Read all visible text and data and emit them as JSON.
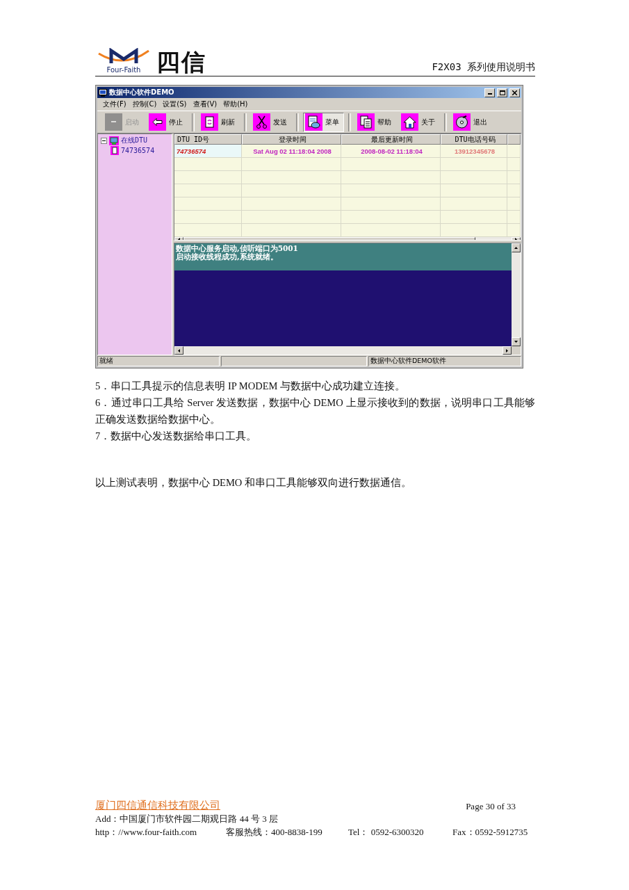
{
  "header": {
    "logo_text": "Four-Faith",
    "logo_mark": "四信",
    "doc_title": "F2X03 系列使用说明书"
  },
  "window": {
    "title": "数据中心软件DEMO",
    "menu": [
      {
        "label": "文件(F)"
      },
      {
        "label": "控制(C)"
      },
      {
        "label": "设置(S)"
      },
      {
        "label": "查看(V)"
      },
      {
        "label": "帮助(H)"
      }
    ],
    "toolbar": [
      {
        "kind": "start",
        "label": "启动",
        "disabled": true,
        "pressed": false,
        "separator_before": false
      },
      {
        "kind": "stop",
        "label": "停止",
        "disabled": false,
        "pressed": false,
        "separator_before": false
      },
      {
        "kind": "refresh",
        "label": "刷新",
        "disabled": false,
        "pressed": false,
        "separator_before": true
      },
      {
        "kind": "send",
        "label": "发送",
        "disabled": false,
        "pressed": false,
        "separator_before": true
      },
      {
        "kind": "menu",
        "label": "菜单",
        "disabled": false,
        "pressed": true,
        "separator_before": true
      },
      {
        "kind": "help",
        "label": "帮助",
        "disabled": false,
        "pressed": false,
        "separator_before": true
      },
      {
        "kind": "about",
        "label": "关于",
        "disabled": false,
        "pressed": false,
        "separator_before": false
      },
      {
        "kind": "exit",
        "label": "退出",
        "disabled": false,
        "pressed": false,
        "separator_before": true
      }
    ],
    "tree": [
      {
        "label": "在线DTU",
        "expanded": true,
        "children": [
          {
            "label": "74736574"
          }
        ]
      }
    ],
    "table": {
      "columns": [
        {
          "label": "DTU ID号",
          "color": "#d01818"
        },
        {
          "label": "登录时间",
          "color": "#c024c0"
        },
        {
          "label": "最后更新时间",
          "color": "#c024c0"
        },
        {
          "label": "DTU电话号码",
          "color": "#e07878"
        }
      ],
      "rows": [
        {
          "selected": true,
          "cells": [
            "74736574",
            "Sat Aug 02 11:18:04 2008",
            "2008-08-02 11:18:04",
            "13912345678"
          ]
        }
      ]
    },
    "log": [
      "数据中心服务启动,侦听端口为5001",
      "启动接收线程成功,系统就绪。"
    ],
    "status_bar": {
      "left": "就绪",
      "right": "数据中心软件DEMO软件"
    }
  },
  "body": [
    "5．串口工具提示的信息表明 IP MODEM 与数据中心成功建立连接。",
    "6．通过串口工具给 Server 发送数据，数据中心 DEMO 上显示接收到的数据，说明串口工具能够正确发送数据给数据中心。",
    "7．数据中心发送数据给串口工具。"
  ],
  "conclusion": "以上测试表明，数据中心 DEMO 和串口工具能够双向进行数据通信。",
  "footer": {
    "company": "厦门四信通信科技有限公司",
    "page": "Page 30 of 33",
    "address": "Add：中国厦门市软件园二期观日路 44 号 3 层",
    "website": "http：//www.four-faith.com",
    "hotline": "客服热线：400-8838-199",
    "tel": "Tel： 0592-6300320",
    "fax": "Fax：0592-5912735"
  }
}
